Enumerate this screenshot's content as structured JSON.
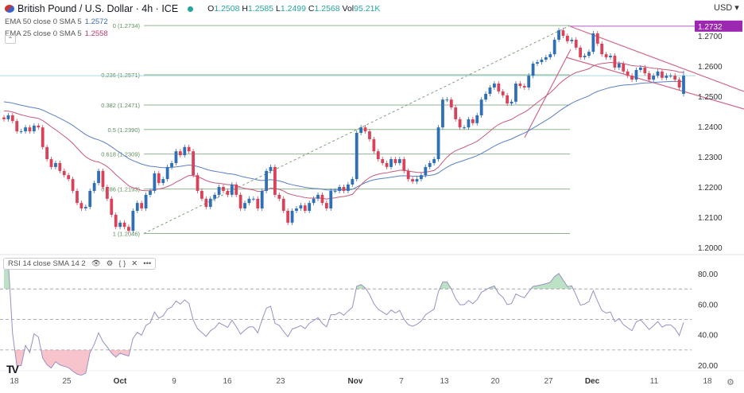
{
  "header": {
    "symbol_title": "British Pound / U.S. Dollar · 4h · ICE",
    "ohlc": {
      "o_label": "O",
      "o": "1.2508",
      "h_label": "H",
      "h": "1.2585",
      "l_label": "L",
      "l": "1.2499",
      "c_label": "C",
      "c": "1.2568",
      "vol_label": "Vol",
      "vol": "95.21K"
    },
    "market_status_color": "#26a69a",
    "currency": "USD ▾"
  },
  "indicators": [
    {
      "label": "EMA 50 close 0 SMA 5",
      "value": "1.2572",
      "color": "#3a6fb0"
    },
    {
      "label": "EMA 25 close 0 SMA 5",
      "value": "1.2558",
      "color": "#c2356f"
    }
  ],
  "rsi_legend": {
    "label": "RSI 14 close SMA 14 2",
    "icons": [
      "eye-icon",
      "settings-icon",
      "source-code-icon",
      "close-icon",
      "more-icon"
    ]
  },
  "chart_data": {
    "type": "candlestick",
    "title": "British Pound / U.S. Dollar · 4h · ICE",
    "colors": {
      "up": "#2f6fb5",
      "down": "#d9435a",
      "ema50": "#5b7fc7",
      "ema25": "#c85a7c",
      "fib": "#8fb58f",
      "channel": "#d06688",
      "resistance": "#b05ac8",
      "rsi": "#9a8fc4"
    },
    "y_ticks": [
      "1.2700",
      "1.2600",
      "1.2500",
      "1.2400",
      "1.2300",
      "1.2200",
      "1.2100",
      "1.2000"
    ],
    "ylim": [
      1.2,
      1.2734
    ],
    "x_ticks": [
      {
        "label": "18",
        "bold": false
      },
      {
        "label": "25",
        "bold": false
      },
      {
        "label": "Oct",
        "bold": true
      },
      {
        "label": "9",
        "bold": false
      },
      {
        "label": "16",
        "bold": false
      },
      {
        "label": "23",
        "bold": false
      },
      {
        "label": "Nov",
        "bold": true
      },
      {
        "label": "7",
        "bold": false
      },
      {
        "label": "13",
        "bold": false
      },
      {
        "label": "20",
        "bold": false
      },
      {
        "label": "27",
        "bold": false
      },
      {
        "label": "Dec",
        "bold": true
      },
      {
        "label": "11",
        "bold": false
      },
      {
        "label": "18",
        "bold": false
      }
    ],
    "closes": [
      1.2424,
      1.2437,
      1.2418,
      1.2384,
      1.2384,
      1.2397,
      1.2384,
      1.2403,
      1.2397,
      1.2332,
      1.2292,
      1.2266,
      1.2279,
      1.2253,
      1.2239,
      1.2226,
      1.2187,
      1.2147,
      1.2129,
      1.2134,
      1.2187,
      1.2213,
      1.2253,
      1.22,
      1.2161,
      1.2108,
      1.2068,
      1.2082,
      1.2068,
      1.2055,
      1.2121,
      1.2147,
      1.2129,
      1.2174,
      1.2187,
      1.2245,
      1.2213,
      1.2226,
      1.2266,
      1.2279,
      1.2318,
      1.2305,
      1.2332,
      1.2318,
      1.2239,
      1.2187,
      1.2161,
      1.2134,
      1.2161,
      1.2174,
      1.22,
      1.2187,
      1.2174,
      1.2208,
      1.2174,
      1.2129,
      1.2147,
      1.2161,
      1.2161,
      1.2129,
      1.2187,
      1.2253,
      1.2266,
      1.2174,
      1.2161,
      1.2121,
      1.2082,
      1.2121,
      1.2129,
      1.2139,
      1.2121,
      1.2147,
      1.2161,
      1.2174,
      1.2147,
      1.2129,
      1.2187,
      1.2187,
      1.22,
      1.2187,
      1.2208,
      1.2226,
      1.2379,
      1.2397,
      1.2384,
      1.2358,
      1.2318,
      1.2292,
      1.2279,
      1.2266,
      1.2292,
      1.2279,
      1.2292,
      1.2253,
      1.2226,
      1.2218,
      1.2226,
      1.2239,
      1.2266,
      1.2279,
      1.2292,
      1.2397,
      1.2489,
      1.2489,
      1.2463,
      1.2424,
      1.2397,
      1.2397,
      1.2424,
      1.2411,
      1.2437,
      1.2489,
      1.2508,
      1.2529,
      1.2542,
      1.2516,
      1.2503,
      1.2476,
      1.2482,
      1.2542,
      1.2534,
      1.2529,
      1.2568,
      1.2608,
      1.2613,
      1.2621,
      1.2629,
      1.2639,
      1.2687,
      1.2718,
      1.27,
      1.2682,
      1.2687,
      1.2661,
      1.2629,
      1.2634,
      1.2647,
      1.2708,
      1.2674,
      1.2639,
      1.2629,
      1.2634,
      1.2595,
      1.2608,
      1.2582,
      1.2568,
      1.2555,
      1.2587,
      1.2595,
      1.2576,
      1.2555,
      1.2568,
      1.2582,
      1.2561,
      1.2568,
      1.2568,
      1.2555,
      1.2529,
      1.2568
    ],
    "last_candle": {
      "open": 1.2508,
      "high": 1.2585,
      "low": 1.2499,
      "close": 1.2568
    },
    "fib_levels": [
      {
        "ratio": "0",
        "price": 1.2734,
        "label": "0 (1.2734)"
      },
      {
        "ratio": "0.236",
        "price": 1.2571,
        "label": "0.236 (1.2571)"
      },
      {
        "ratio": "0.382",
        "price": 1.2471,
        "label": "0.382 (1.2471)"
      },
      {
        "ratio": "0.5",
        "price": 1.239,
        "label": "0.5 (1.2390)"
      },
      {
        "ratio": "0.618",
        "price": 1.2309,
        "label": "0.618 (1.2309)"
      },
      {
        "ratio": "0.786",
        "price": 1.2193,
        "label": "0.786 (1.2193)"
      },
      {
        "ratio": "1",
        "price": 1.2046,
        "label": "1 (1.2046)"
      }
    ],
    "resistance": {
      "price": 1.2732,
      "label": "1.2732"
    },
    "rsi": {
      "period": 14,
      "ticks": [
        "80.00",
        "60.00",
        "40.00",
        "20.00"
      ],
      "overbought": 70,
      "oversold": 30,
      "mid": 50,
      "ylim": [
        20,
        80
      ]
    }
  }
}
